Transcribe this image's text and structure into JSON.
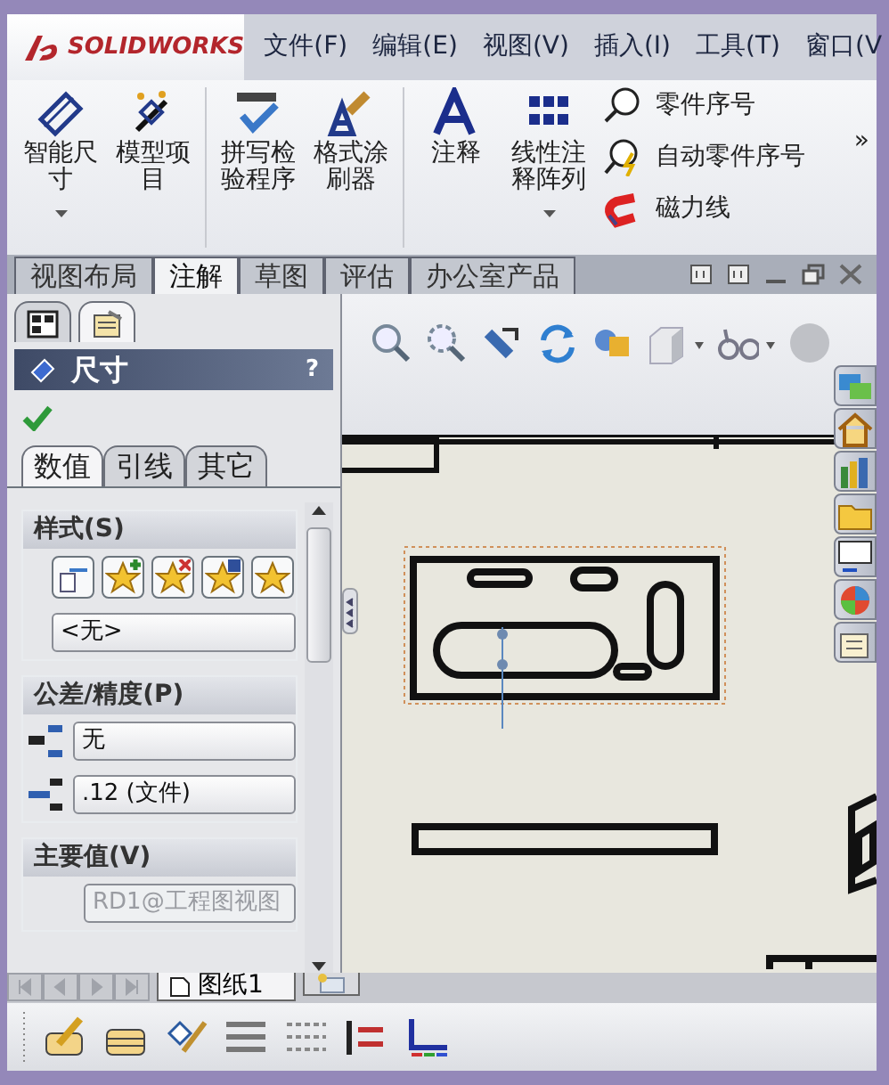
{
  "logo": {
    "text": "SOLIDWORKS"
  },
  "menu": [
    {
      "label": "文件(F)"
    },
    {
      "label": "编辑(E)"
    },
    {
      "label": "视图(V)"
    },
    {
      "label": "插入(I)"
    },
    {
      "label": "工具(T)"
    },
    {
      "label": "窗口(V"
    }
  ],
  "ribbon": {
    "large_buttons": [
      {
        "label": "智能尺寸",
        "dropdown": true
      },
      {
        "label": "模型项目",
        "dropdown": false
      },
      {
        "label": "拼写检验程序",
        "dropdown": false
      },
      {
        "label": "格式涂刷器",
        "dropdown": false
      },
      {
        "label": "注释",
        "dropdown": false
      },
      {
        "label": "线性注释阵列",
        "dropdown": true
      }
    ],
    "small_buttons": [
      {
        "label": "零件序号"
      },
      {
        "label": "自动零件序号"
      },
      {
        "label": "磁力线"
      }
    ],
    "overflow": "»"
  },
  "command_tabs": [
    {
      "label": "视图布局",
      "selected": false
    },
    {
      "label": "注解",
      "selected": true
    },
    {
      "label": "草图",
      "selected": false
    },
    {
      "label": "评估",
      "selected": false
    },
    {
      "label": "办公室产品",
      "selected": false
    }
  ],
  "property_manager": {
    "panel_tabs": [
      {
        "selected": false
      },
      {
        "selected": true
      }
    ],
    "title": "尺寸",
    "help": "?",
    "tabs": [
      {
        "label": "数值",
        "selected": true
      },
      {
        "label": "引线",
        "selected": false
      },
      {
        "label": "其它",
        "selected": false
      }
    ],
    "groups": [
      {
        "title": "样式(S)",
        "fields": [
          {
            "value": "<无>",
            "disabled": false
          }
        ]
      },
      {
        "title": "公差/精度(P)",
        "fields": [
          {
            "value": "无",
            "disabled": false
          },
          {
            "value": ".12 (文件)",
            "disabled": false
          }
        ]
      },
      {
        "title": "主要值(V)",
        "fields": [
          {
            "value": "RD1@工程图视图",
            "disabled": true
          }
        ]
      }
    ]
  },
  "sheet_tabs": [
    {
      "kind": "sheet",
      "label": "图纸1",
      "selected": true
    },
    {
      "kind": "add",
      "selected": false
    }
  ]
}
